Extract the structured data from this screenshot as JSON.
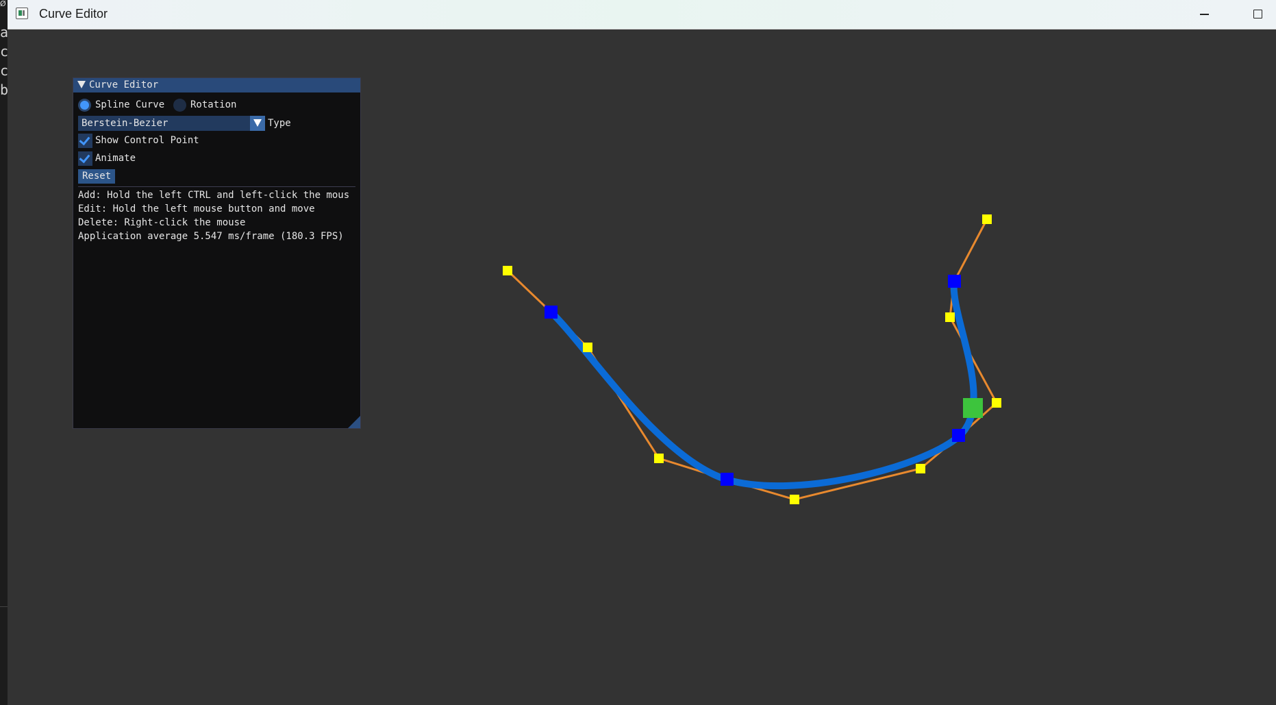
{
  "window": {
    "title": "Curve Editor"
  },
  "behind_window": {
    "fragments": [
      "a",
      "c",
      "c",
      "b"
    ],
    "corner_glyph": "Ø"
  },
  "panel": {
    "title": "Curve Editor",
    "mode_radio": [
      {
        "label": "Spline Curve",
        "selected": true
      },
      {
        "label": "Rotation",
        "selected": false
      }
    ],
    "type_combo": {
      "value": "Berstein-Bezier",
      "label": "Type"
    },
    "show_control_point": {
      "label": "Show Control Point",
      "checked": true
    },
    "animate": {
      "label": "Animate",
      "checked": true
    },
    "reset_label": "Reset",
    "help_lines": [
      "Add: Hold the left CTRL and left-click the mous",
      "Edit: Hold the left mouse button and move",
      "Delete: Right-click the mouse",
      "Application average 5.547 ms/frame (180.3 FPS)"
    ]
  },
  "colors": {
    "curve": "#0b6bd6",
    "control_polygon": "#e8892e",
    "anchor_point": "#0000ff",
    "handle_point": "#ffff00",
    "animated_marker": "#3dc43d",
    "accent": "#4296fa"
  }
}
